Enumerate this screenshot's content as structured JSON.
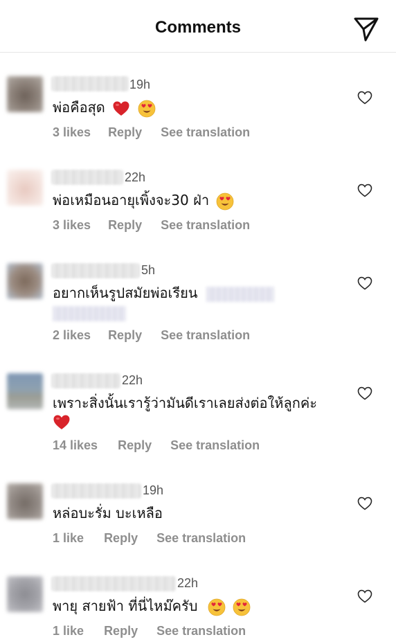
{
  "header": {
    "title": "Comments"
  },
  "colors": {
    "meta_text": "#8e8e8e",
    "heart_emoji": "#d8232a",
    "heart_eyes_face": "#f7c23a"
  },
  "comments": [
    {
      "time": "19h",
      "text": "พ่อคือสุด",
      "likes": "3 likes",
      "reply": "Reply",
      "translation": "See translation",
      "emojis": [
        "red-heart",
        "heart-eyes"
      ]
    },
    {
      "time": "22h",
      "text": "พ่อเหมือนอายุเพิ้งจะ30 ฝ่า",
      "likes": "3 likes",
      "reply": "Reply",
      "translation": "See translation",
      "emojis": [
        "heart-eyes"
      ]
    },
    {
      "time": "5h",
      "text": "อยากเห็นรูปสมัยพ่อเรียน",
      "likes": "2 likes",
      "reply": "Reply",
      "translation": "See translation",
      "emojis": []
    },
    {
      "time": "22h",
      "text": "เพราะสิ่งนั้นเรารู้ว่ามันดีเราเลยส่งต่อให้ลูกค่ะ",
      "likes": "14 likes",
      "reply": "Reply",
      "translation": "See translation",
      "emojis": [
        "red-heart"
      ]
    },
    {
      "time": "19h",
      "text": "หล่อบะรั่ม บะเหลือ",
      "likes": "1 like",
      "reply": "Reply",
      "translation": "See translation",
      "emojis": []
    },
    {
      "time": "22h",
      "text": "พายุ สายฟ้า ที่นี่ไหม๊ครับ",
      "likes": "1 like",
      "reply": "Reply",
      "translation": "See translation",
      "emojis": [
        "heart-eyes",
        "heart-eyes"
      ]
    }
  ]
}
